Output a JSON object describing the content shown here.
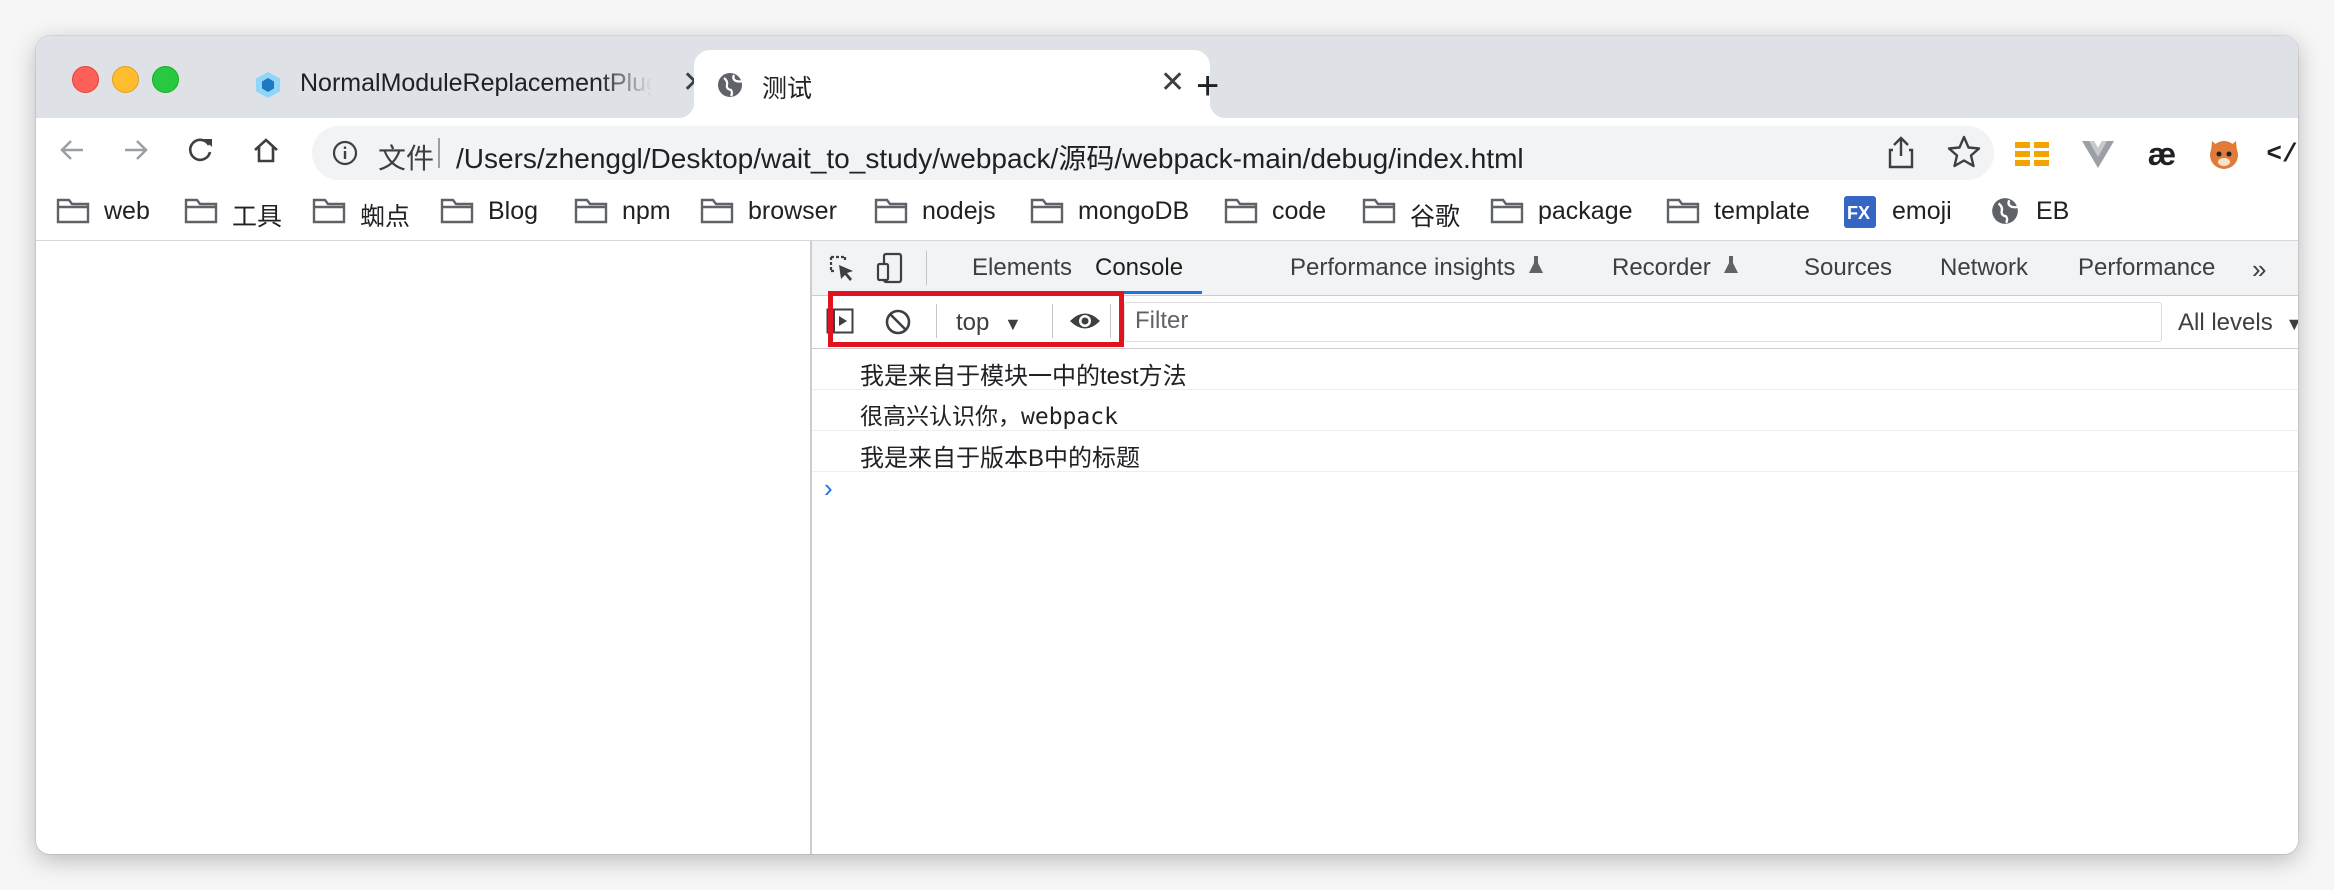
{
  "tabs": [
    {
      "title": "NormalModuleReplacementPlugin",
      "favicon": "webpack-cube-icon"
    },
    {
      "title": "测试",
      "favicon": "globe-icon"
    }
  ],
  "toolbar": {
    "scheme_label": "文件",
    "url": "/Users/zhenggl/Desktop/wait_to_study/webpack/源码/webpack-main/debug/index.html"
  },
  "bookmarks": [
    {
      "label": "web",
      "icon": "folder-icon"
    },
    {
      "label": "工具",
      "icon": "folder-icon"
    },
    {
      "label": "蜘点",
      "icon": "folder-icon"
    },
    {
      "label": "Blog",
      "icon": "folder-icon"
    },
    {
      "label": "npm",
      "icon": "folder-icon"
    },
    {
      "label": "browser",
      "icon": "folder-icon"
    },
    {
      "label": "nodejs",
      "icon": "folder-icon"
    },
    {
      "label": "mongoDB",
      "icon": "folder-icon"
    },
    {
      "label": "code",
      "icon": "folder-icon"
    },
    {
      "label": "谷歌",
      "icon": "folder-icon"
    },
    {
      "label": "package",
      "icon": "folder-icon"
    },
    {
      "label": "template",
      "icon": "folder-icon"
    },
    {
      "label": "emoji",
      "icon": "fx-icon"
    },
    {
      "label": "EB",
      "icon": "globe-icon"
    }
  ],
  "devtools": {
    "tabs": [
      "Elements",
      "Console",
      "Performance insights",
      "Recorder",
      "Sources",
      "Network",
      "Performance"
    ],
    "active_tab": "Console",
    "context": "top",
    "filter_placeholder": "Filter",
    "levels": "All levels",
    "messages": [
      "我是来自于模块一中的test方法",
      "很高兴认识你，webpack",
      "我是来自于版本B中的标题"
    ],
    "highlighted_message": 2
  },
  "colors": {
    "tabstrip": "#dee1e6",
    "accent": "#1a73e8",
    "highlight_border": "#e0141e"
  }
}
